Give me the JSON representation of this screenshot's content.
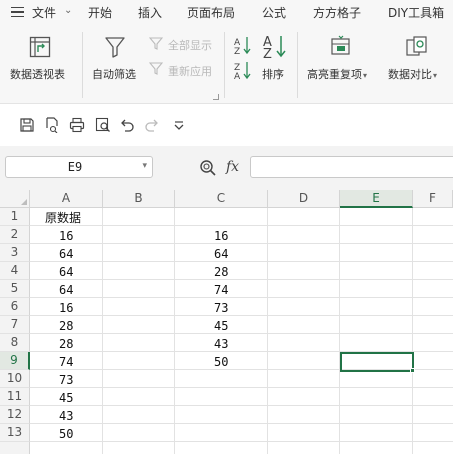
{
  "menu": {
    "file": "文件",
    "tabs": [
      "开始",
      "插入",
      "页面布局",
      "公式",
      "方方格子",
      "DIY工具箱"
    ]
  },
  "ribbon": {
    "pivot_table": "数据透视表",
    "auto_filter": "自动筛选",
    "show_all": "全部显示",
    "reapply": "重新应用",
    "sort": "排序",
    "highlight_duplicates": "高亮重复项",
    "data_compare": "数据对比"
  },
  "formula_bar": {
    "name_box": "E9",
    "fx": "fx",
    "formula": ""
  },
  "grid": {
    "columns": [
      "A",
      "B",
      "C",
      "D",
      "E",
      "F"
    ],
    "rows": [
      "1",
      "2",
      "3",
      "4",
      "5",
      "6",
      "7",
      "8",
      "9",
      "10",
      "11",
      "12",
      "13"
    ],
    "col_a": [
      "原数据",
      "16",
      "64",
      "64",
      "64",
      "16",
      "28",
      "28",
      "74",
      "73",
      "45",
      "43",
      "50"
    ],
    "col_c": [
      "",
      "16",
      "64",
      "28",
      "74",
      "73",
      "45",
      "43",
      "50",
      "",
      "",
      "",
      ""
    ],
    "selected_cell": "E9",
    "accent_color": "#217346"
  },
  "icons": {
    "quick_access": [
      "save-icon",
      "print-preview-icon",
      "print-icon",
      "find-icon",
      "undo-icon",
      "redo-icon",
      "customize-icon"
    ]
  }
}
